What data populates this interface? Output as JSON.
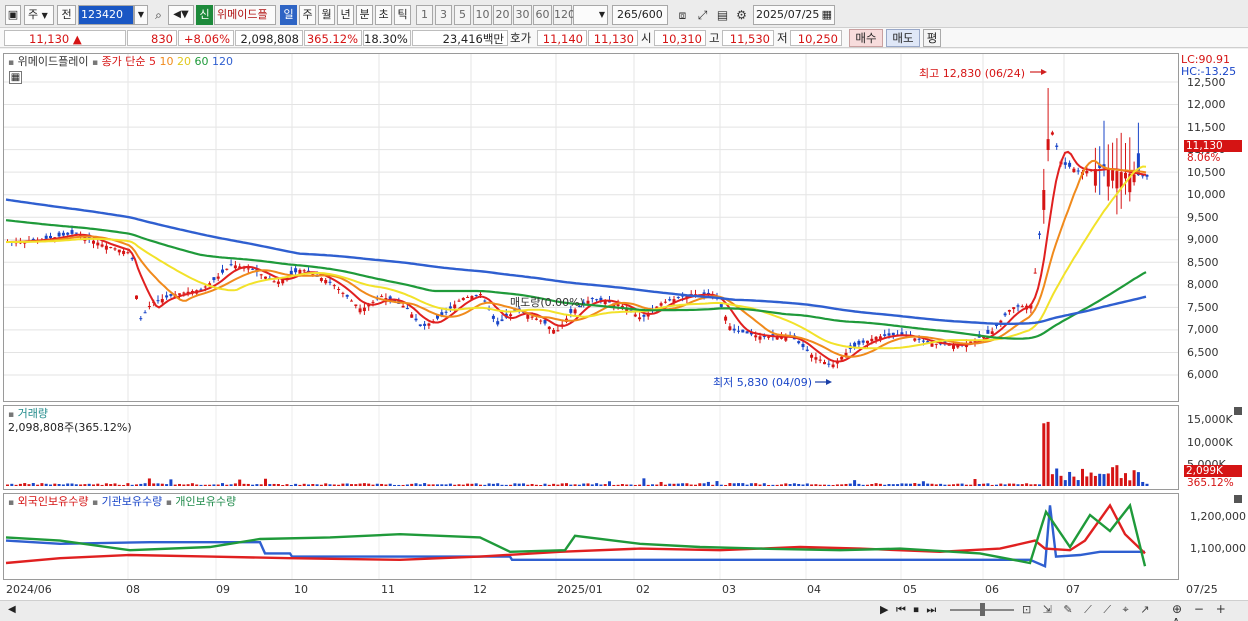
{
  "toolbar": {
    "market_label": "주",
    "prev_label": "전",
    "code_value": "123420",
    "stock_name": "위메이드플",
    "new_badge": "신",
    "periods": [
      "일",
      "주",
      "월",
      "년",
      "분",
      "초",
      "틱"
    ],
    "intervals": [
      "1",
      "3",
      "5",
      "10",
      "20",
      "30",
      "60",
      "120"
    ],
    "count_value": "265",
    "count_total": "/600",
    "date_value": "2025/07/25"
  },
  "info": {
    "price": "11,130",
    "change_arrow": "▲",
    "change": "830",
    "change_pct": "+8.06%",
    "volume": "2,098,808",
    "volume_ratio": "365.12%",
    "turnover": "18.30%",
    "amount": "23,416백만",
    "quote_label": "호가",
    "ask": "11,140",
    "bid": "11,130",
    "open_label": "시",
    "open": "10,310",
    "high_label": "고",
    "high": "11,530",
    "low_label": "저",
    "low": "10,250",
    "buy_label": "매수",
    "sell_label": "매도",
    "eq_label": "평"
  },
  "price_panel": {
    "stock_label": "위메이드플레이",
    "ma_title": "종가 단순",
    "ma_periods": [
      "5",
      "10",
      "20",
      "60",
      "120"
    ],
    "lc": "LC:90.91",
    "hc": "HC:-13.25",
    "high_annotation": "최고 12,830 (06/24)",
    "low_annotation": "최저 5,830 (04/09)",
    "mid_annotation": "매도량(0.00%)",
    "y_labels": [
      "12,500",
      "12,000",
      "11,500",
      "11,000",
      "10,500",
      "10,000",
      "9,500",
      "9,000",
      "8,500",
      "8,000",
      "7,500",
      "7,000",
      "6,500",
      "6,000"
    ],
    "last_price": "11,130",
    "last_pct": "8.06%"
  },
  "volume_panel": {
    "title": "거래량",
    "value": "2,098,808주(365.12%)",
    "y_labels": [
      "15,000K",
      "10,000K",
      "5,000K"
    ],
    "last_value": "2,099K",
    "last_pct": "365.12%"
  },
  "holding_panel": {
    "foreign_label": "외국인보유수량",
    "inst_label": "기관보유수량",
    "indiv_label": "개인보유수량",
    "y_labels": [
      "1,200,000",
      "1,100,000"
    ]
  },
  "x_axis": {
    "labels": [
      "2024/06",
      "08",
      "09",
      "10",
      "11",
      "12",
      "2025/01",
      "02",
      "03",
      "04",
      "05",
      "06",
      "07",
      "07/25"
    ]
  },
  "colors": {
    "ma5": "#e02020",
    "ma10": "#f08a1c",
    "ma20": "#f2e22a",
    "ma60": "#1f9a3a",
    "ma120": "#2f5fd0",
    "up": "#d51414",
    "down": "#1a46c8"
  }
}
